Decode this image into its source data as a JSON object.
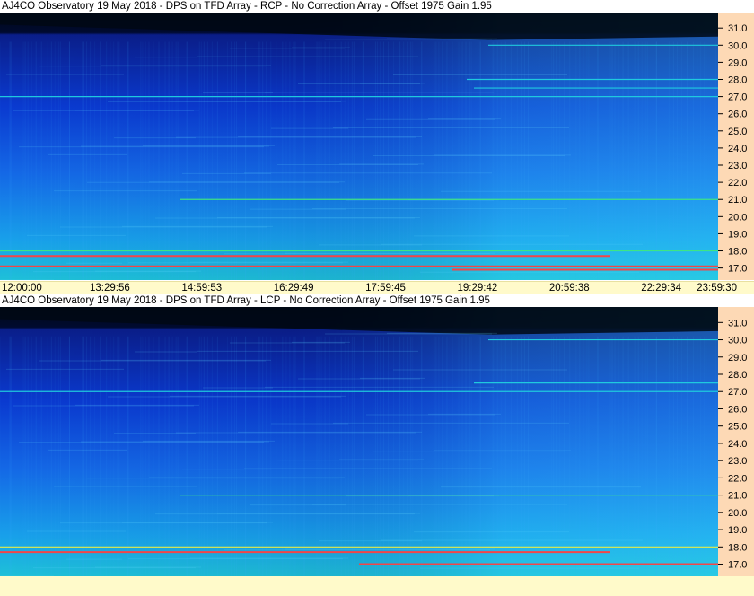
{
  "colors": {
    "background_dark": "#000814",
    "background_blue": "#0030c8",
    "mid_blue": "#1a7cf0",
    "cyan": "#20d0e0",
    "green": "#40e880",
    "yellow": "#f0f040",
    "red": "#ff4040",
    "right_axis_bg": "#fdd9b5",
    "x_axis_bg": "#fffaca"
  },
  "chart_data": [
    {
      "type": "heatmap",
      "title": "AJ4CO Observatory 19 May 2018 - DPS on TFD Array  - RCP  -  No Correction Array  -  Offset 1975  Gain 1.95",
      "x_tick_labels": [
        "12:00:00",
        "13:29:56",
        "14:59:53",
        "16:29:49",
        "17:59:45",
        "19:29:42",
        "20:59:38",
        "22:29:34",
        "23:59:30"
      ],
      "y_tick_labels": [
        "31.0",
        "30.0",
        "29.0",
        "28.0",
        "27.0",
        "26.0",
        "25.0",
        "24.0",
        "23.0",
        "22.0",
        "21.0",
        "20.0",
        "19.0",
        "18.0",
        "17.0"
      ],
      "ylim": [
        16.3,
        31.9
      ],
      "emission_lines": [
        {
          "freq": 30.0,
          "intensity": 0.45,
          "start": 0.68,
          "end": 1.0
        },
        {
          "freq": 28.0,
          "intensity": 0.5,
          "start": 0.65,
          "end": 1.0
        },
        {
          "freq": 27.5,
          "intensity": 0.55,
          "start": 0.66,
          "end": 1.0
        },
        {
          "freq": 27.0,
          "intensity": 0.5,
          "start": 0.0,
          "end": 1.0
        },
        {
          "freq": 21.0,
          "intensity": 0.7,
          "start": 0.25,
          "end": 1.0
        },
        {
          "freq": 18.0,
          "intensity": 0.75,
          "start": 0.0,
          "end": 1.0
        },
        {
          "freq": 17.7,
          "intensity": 0.95,
          "start": 0.0,
          "end": 0.85
        },
        {
          "freq": 17.1,
          "intensity": 0.9,
          "start": 0.0,
          "end": 1.0
        },
        {
          "freq": 16.9,
          "intensity": 1.0,
          "start": 0.63,
          "end": 1.0
        }
      ]
    },
    {
      "type": "heatmap",
      "title": "AJ4CO Observatory 19 May 2018 - DPS on TFD Array  - LCP  -  No Correction Array  -  Offset 1975  Gain 1.95",
      "x_tick_labels": [],
      "y_tick_labels": [
        "31.0",
        "30.0",
        "29.0",
        "28.0",
        "27.0",
        "26.0",
        "25.0",
        "24.0",
        "23.0",
        "22.0",
        "21.0",
        "20.0",
        "19.0",
        "18.0",
        "17.0"
      ],
      "ylim": [
        16.3,
        31.9
      ],
      "emission_lines": [
        {
          "freq": 30.0,
          "intensity": 0.45,
          "start": 0.68,
          "end": 1.0
        },
        {
          "freq": 27.5,
          "intensity": 0.55,
          "start": 0.66,
          "end": 1.0
        },
        {
          "freq": 27.0,
          "intensity": 0.5,
          "start": 0.0,
          "end": 1.0
        },
        {
          "freq": 21.0,
          "intensity": 0.7,
          "start": 0.25,
          "end": 1.0
        },
        {
          "freq": 18.0,
          "intensity": 0.8,
          "start": 0.0,
          "end": 1.0
        },
        {
          "freq": 17.7,
          "intensity": 0.95,
          "start": 0.0,
          "end": 0.85
        },
        {
          "freq": 17.0,
          "intensity": 1.0,
          "start": 0.5,
          "end": 1.0
        }
      ]
    }
  ]
}
